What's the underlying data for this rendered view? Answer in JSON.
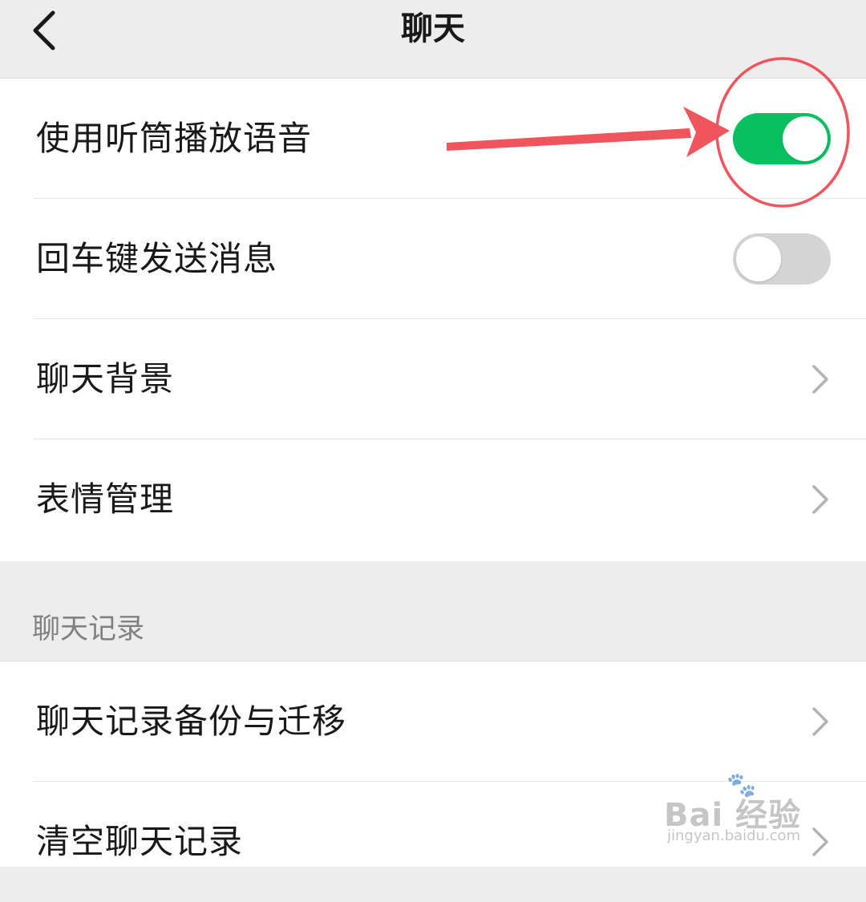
{
  "nav": {
    "title": "聊天",
    "back_icon": "chevron-left-icon"
  },
  "settings_group": {
    "rows": [
      {
        "label": "使用听筒播放语音",
        "control": "toggle",
        "enabled": true
      },
      {
        "label": "回车键发送消息",
        "control": "toggle",
        "enabled": false
      },
      {
        "label": "聊天背景",
        "control": "chevron"
      },
      {
        "label": "表情管理",
        "control": "chevron"
      }
    ]
  },
  "history_section": {
    "header": "聊天记录",
    "rows": [
      {
        "label": "聊天记录备份与迁移",
        "control": "chevron"
      },
      {
        "label": "清空聊天记录",
        "control": "chevron"
      }
    ]
  },
  "watermark": {
    "brand": "Bai  经验",
    "url": "jingyan.baidu.com"
  },
  "colors": {
    "toggle_on": "#07c160",
    "toggle_off": "#d4d4d4",
    "annotation": "#f0545c",
    "background": "#ededed"
  }
}
